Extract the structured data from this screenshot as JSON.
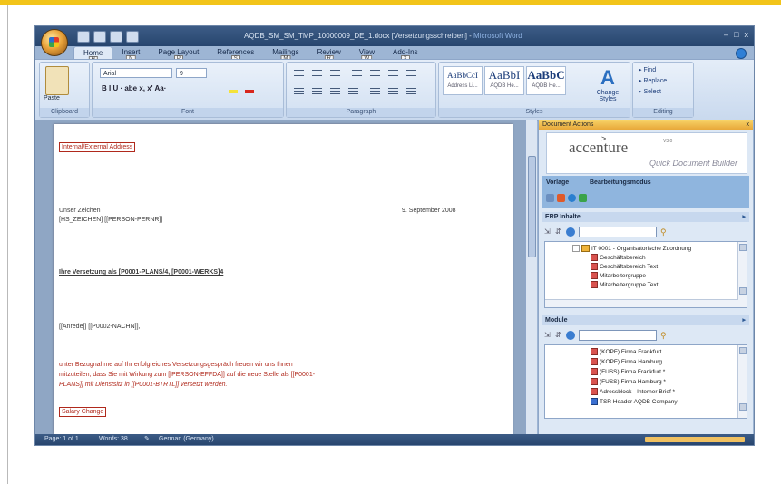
{
  "window": {
    "title": "AQDB_SM_SM_TMP_10000009_DE_1.docx [Versetzungsschreiben]",
    "app_name": "Microsoft Word"
  },
  "tabs": [
    {
      "label": "Home",
      "key": "H"
    },
    {
      "label": "Insert",
      "key": "N"
    },
    {
      "label": "Page Layout",
      "key": "P"
    },
    {
      "label": "References",
      "key": "S"
    },
    {
      "label": "Mailings",
      "key": "M"
    },
    {
      "label": "Review",
      "key": "R"
    },
    {
      "label": "View",
      "key": "W"
    },
    {
      "label": "Add-Ins",
      "key": "X"
    }
  ],
  "ribbon": {
    "clipboard": {
      "label": "Clipboard",
      "paste": "Paste"
    },
    "font": {
      "label": "Font",
      "name": "Arial",
      "size": "9",
      "format_buttons": "B  I  U · abe x, x' Aa·"
    },
    "paragraph": {
      "label": "Paragraph"
    },
    "styles": {
      "label": "Styles",
      "items": [
        {
          "preview": "AaBbCcI",
          "name": "Address Li..."
        },
        {
          "preview": "AaBbI",
          "name": "AQDB He..."
        },
        {
          "preview": "AaBbC",
          "name": "AQDB He..."
        }
      ],
      "change_styles": "Change Styles"
    },
    "editing": {
      "label": "Editing",
      "find": "Find",
      "replace": "Replace",
      "select": "Select"
    }
  },
  "document": {
    "address": "Internal/External Address",
    "sender_line1": "Unser Zeichen",
    "sender_line2": "[HS_ZEICHEN] [[PERSON-PERNR]]",
    "date": "9. September 2008",
    "subject": "Ihre Versetzung als [P0001-PLANS/4, [P0001-WERKS]4",
    "salutation": "[[Anrede]] [[P0002-NACHN]],",
    "body_line1": "unter Bezugnahme auf Ihr erfolgreiches Versetzungsgespräch freuen wir uns Ihnen",
    "body_line2": "mitzuteilen, dass Sie mit Wirkung zum [[PERSON-EFFDA]] auf die neue Stelle als [[P0001-",
    "body_line3": "PLANS]] mit Dienstsitz in [[P0001-BTRTL]] versetzt werden.",
    "salary": "Salary Change"
  },
  "pane": {
    "title": "Document Actions",
    "close": "x",
    "brand": "accenture",
    "version": "V3.0",
    "product": "Quick Document Builder",
    "col_vorlage": "Vorlage",
    "col_bearb": "Bearbeitungsmodus",
    "erp_section": "ERP Inhalte",
    "module_section": "Module",
    "erp_tree": [
      {
        "label": "IT 0001 - Organisatorische Zuordnung",
        "level": 0,
        "type": "folder"
      },
      {
        "label": "Geschäftsbereich",
        "level": 1,
        "type": "field"
      },
      {
        "label": "Geschäftsbereich Text",
        "level": 1,
        "type": "field"
      },
      {
        "label": "Mitarbeitergruppe",
        "level": 1,
        "type": "field"
      },
      {
        "label": "Mitarbeitergruppe Text",
        "level": 1,
        "type": "field"
      }
    ],
    "module_tree": [
      {
        "label": "(KOPF) Firma Frankfurt"
      },
      {
        "label": "(KOPF) Firma Hamburg"
      },
      {
        "label": "(FUSS) Firma Frankfurt *"
      },
      {
        "label": "(FUSS) Firma Hamburg *"
      },
      {
        "label": "Adressblock - Interner Brief *"
      },
      {
        "label": "TSR Header AQDB Company"
      }
    ]
  },
  "status": {
    "page": "Page: 1 of 1",
    "words": "Words: 38",
    "language": "German (Germany)"
  },
  "colors": {
    "accent_top": "#f2c41a",
    "field_red": "#b0291c",
    "pane_header": "#e8a83a"
  }
}
